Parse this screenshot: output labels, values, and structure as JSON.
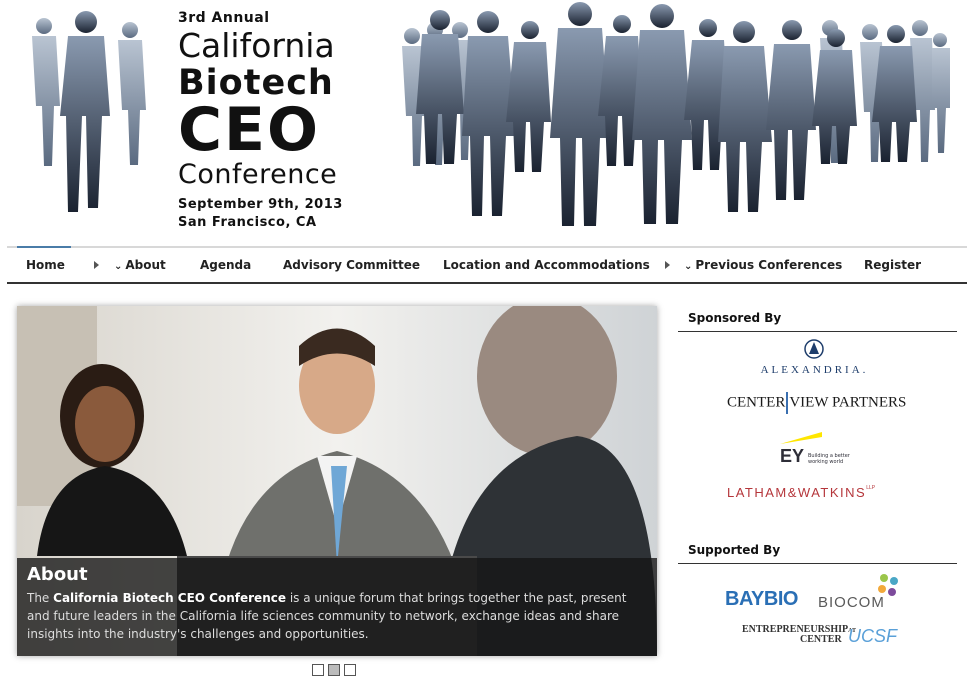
{
  "header": {
    "annual": "3rd Annual",
    "title_line1": "California",
    "title_line2": "Biotech",
    "title_line3": "CEO",
    "title_line4": "Conference",
    "date": "September 9th, 2013",
    "city": "San Francisco, CA"
  },
  "nav": {
    "items": [
      {
        "label": "Home"
      },
      {
        "label": "About"
      },
      {
        "label": "Agenda"
      },
      {
        "label": "Advisory Committee"
      },
      {
        "label": "Location and Accommodations"
      },
      {
        "label": "Previous Conferences"
      },
      {
        "label": "Register"
      }
    ]
  },
  "slider": {
    "heading": "About",
    "text_before": "The ",
    "text_bold": "California Biotech CEO Conference",
    "text_after": " is a unique forum that brings together the past, present and future leaders in the California life sciences community to network, exchange ideas and share insights into the industry's challenges and opportunities.",
    "slide_count": 3,
    "active_slide": 2
  },
  "sidebar": {
    "sponsored_heading": "Sponsored By",
    "supported_heading": "Supported By",
    "sponsors": {
      "alexandria": "ALEXANDRIA.",
      "centerview_left": "CENTER",
      "centerview_right": "VIEW PARTNERS",
      "ey_mark": "EY",
      "ey_tagline1": "Building a better",
      "ey_tagline2": "working world",
      "latham": "LATHAM&WATKINS",
      "latham_llp": "LLP"
    },
    "supporters": {
      "baybio": "BAYBIO",
      "biocom": "BIOCOM",
      "ucsf_line1": "ENTREPRENEURSHIP",
      "ucsf_at": "AT",
      "ucsf_line2": "CENTER",
      "ucsf_mark": "UCSF"
    }
  },
  "colors": {
    "nav_active": "#4a7ca8",
    "silhouette": "#3e4f66",
    "latham_red": "#b5363b",
    "baybio_blue": "#2a6fb5",
    "ucsf_blue": "#5aa0d8",
    "ey_yellow": "#ffe600"
  }
}
